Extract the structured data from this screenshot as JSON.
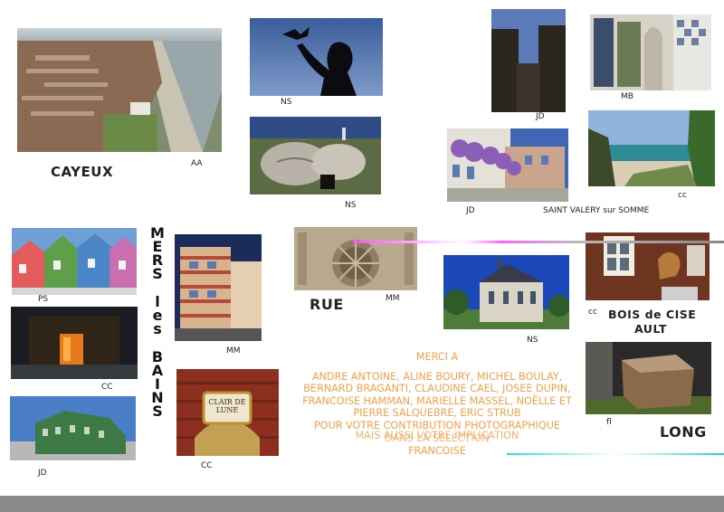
{
  "places": {
    "cayeux": "CAYEUX",
    "saint_valery": "SAINT VALERY sur SOMME",
    "rue": "RUE",
    "bois_de_cise": "BOIS de CISE",
    "ault": "AULT",
    "long": "LONG",
    "mers_les_bains_letters": [
      "M",
      "E",
      "R",
      "S",
      "",
      "l",
      "e",
      "s",
      "",
      "B",
      "A",
      "I",
      "N",
      "S"
    ]
  },
  "credits": {
    "aa": "AA",
    "ns1": "NS",
    "ns2": "NS",
    "jd1": "JD",
    "mb": "MB",
    "jd2": "JD",
    "cc1": "cc",
    "ps": "PS",
    "mm1": "MM",
    "mm2": "MM",
    "cc2": "cc",
    "ns3": "NS",
    "cc3": "CC",
    "jd3": "JD",
    "cc4": "CC",
    "fl": "fl",
    "clair_de_lune": "CLAIR DE LUNE"
  },
  "thanks": {
    "heading": "MERCI A",
    "names": "ANDRE ANTOINE, ALINE BOURY, MICHEL BOULAY, BERNARD BRAGANTI, CLAUDINE CAEL, JOSEE DUPIN, FRANCOISE HAMMAN, MARIELLE MASSEL, NOËLLE ET PIERRE SALQUEBRE, ERIC STRUB",
    "line_contribution": "POUR VOTRE CONTRIBUTION PHOTOGRAPHIQUE",
    "line_overlap": "MAIS AUSSI VOTRE IMPLICATION",
    "line_selection": "DANS LA SELECTION",
    "signature": "FRANCOISE"
  }
}
